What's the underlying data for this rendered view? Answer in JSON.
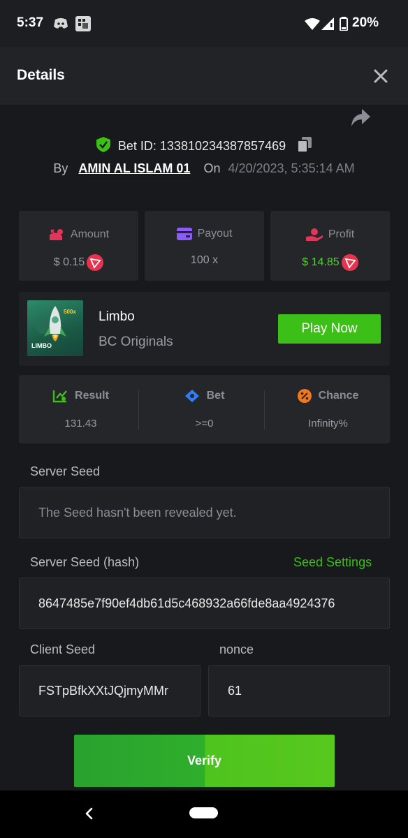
{
  "status_bar": {
    "time": "5:37",
    "battery": "20%",
    "icons": [
      "discord-icon",
      "app-grid-icon",
      "wifi-icon",
      "signal-icon",
      "battery-icon"
    ]
  },
  "header": {
    "title": "Details",
    "close_icon": "close-icon"
  },
  "bet": {
    "share_icon": "share-icon",
    "id_label": "Bet ID: 133810234387857469",
    "by_label": "By",
    "user": "AMIN AL ISLAM 01",
    "on_label": "On",
    "date": "4/20/2023, 5:35:14 AM"
  },
  "stats": [
    {
      "label": "Amount",
      "value": "$ 0.15",
      "icon": "amount-icon"
    },
    {
      "label": "Payout",
      "value": "100 x",
      "icon": "payout-icon"
    },
    {
      "label": "Profit",
      "value": "$ 14.85",
      "icon": "profit-icon"
    }
  ],
  "game": {
    "thumb_badge": "500x",
    "thumb_label": "LIMBO",
    "name": "Limbo",
    "provider": "BC Originals",
    "play_label": "Play Now"
  },
  "results": [
    {
      "label": "Result",
      "value": "131.43",
      "icon": "result-icon"
    },
    {
      "label": "Bet",
      "value": ">=0",
      "icon": "bet-icon"
    },
    {
      "label": "Chance",
      "value": "Infinity%",
      "icon": "chance-icon"
    }
  ],
  "seeds": {
    "server_seed_label": "Server Seed",
    "server_seed_value": "The Seed hasn't been revealed yet.",
    "server_hash_label": "Server Seed (hash)",
    "seed_settings_label": "Seed Settings",
    "server_hash_value": "8647485e7f90ef4db61d5c468932a66fde8aa4924376",
    "client_seed_label": "Client Seed",
    "client_seed_value": "FSTpBfkXXtJQjmyMMr",
    "nonce_label": "nonce",
    "nonce_value": "61"
  },
  "verify_label": "Verify",
  "colors": {
    "accent_green": "#3cbf17",
    "background": "#18191c",
    "card": "#25262a"
  }
}
